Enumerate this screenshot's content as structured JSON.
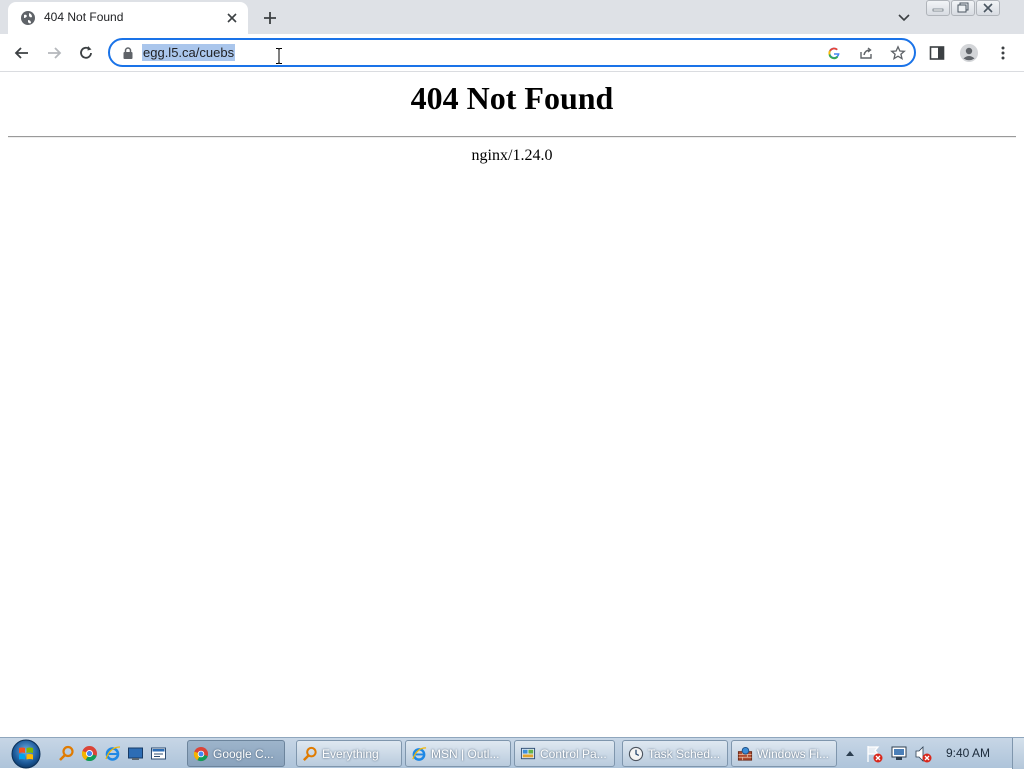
{
  "browser": {
    "tab": {
      "title": "404 Not Found"
    },
    "address_bar": {
      "url": "egg.l5.ca/cuebs"
    }
  },
  "page": {
    "heading": "404 Not Found",
    "server": "nginx/1.24.0"
  },
  "taskbar": {
    "tasks": [
      {
        "label": "Google C...",
        "icon": "chrome-icon"
      },
      {
        "label": "Everything",
        "icon": "everything-icon"
      },
      {
        "label": "MSN | Outl...",
        "icon": "ie-icon"
      },
      {
        "label": "Control Pa...",
        "icon": "control-panel-icon"
      },
      {
        "label": "Task Sched...",
        "icon": "task-scheduler-icon"
      },
      {
        "label": "Windows Fi...",
        "icon": "windows-firewall-icon"
      }
    ],
    "clock": "9:40 AM"
  },
  "colors": {
    "accent": "#1a73e8",
    "selection": "#aac6ec",
    "tabstrip": "#dee1e6"
  }
}
